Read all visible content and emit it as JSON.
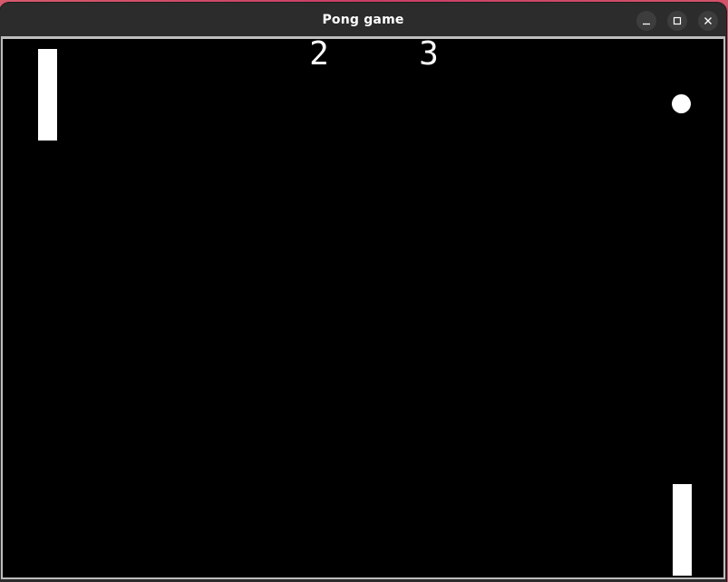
{
  "window": {
    "title": "Pong game"
  },
  "controls": {
    "minimize_icon": "minimize-icon",
    "maximize_icon": "maximize-icon",
    "close_icon": "close-icon"
  },
  "game": {
    "score_left": "2",
    "score_right": "3",
    "colors": {
      "background": "#000000",
      "foreground": "#ffffff"
    }
  }
}
